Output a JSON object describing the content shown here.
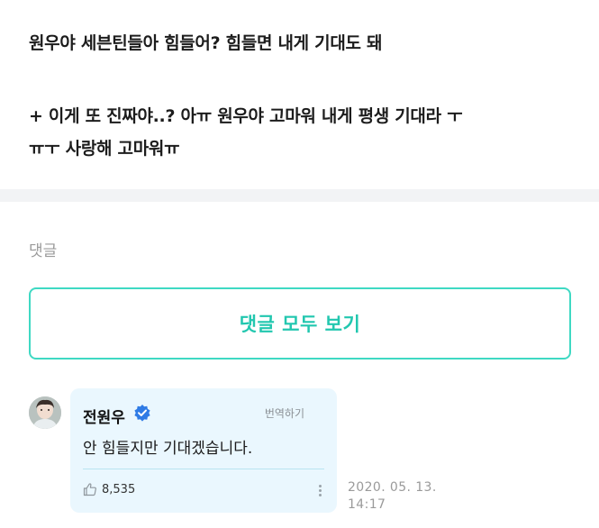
{
  "post": {
    "line1": "원우야 세븐틴들아 힘들어? 힘들면 내게 기대도 돼",
    "line2": "+ 이게 또 진짜야..? 아ㅠ 원우야 고마워 내게 평생 기대라 ㅜ",
    "line3": "ㅠㅜ 사랑해 고마워ㅠ"
  },
  "comments": {
    "section_label": "댓글",
    "view_all_label": "댓글 모두 보기",
    "items": [
      {
        "author": "전원우",
        "verified_icon": "verified-badge-icon",
        "translate_label": "번역하기",
        "text": "안 힘들지만 기대겠습니다.",
        "likes": "8,535",
        "date": "2020. 05. 13.",
        "time": "14:17"
      }
    ]
  },
  "colors": {
    "accent": "#22c7af",
    "accent_border": "#3fd9c3",
    "bubble_bg": "#eaf7fe",
    "verified_blue": "#2f7be5",
    "divider": "#f2f3f5"
  }
}
